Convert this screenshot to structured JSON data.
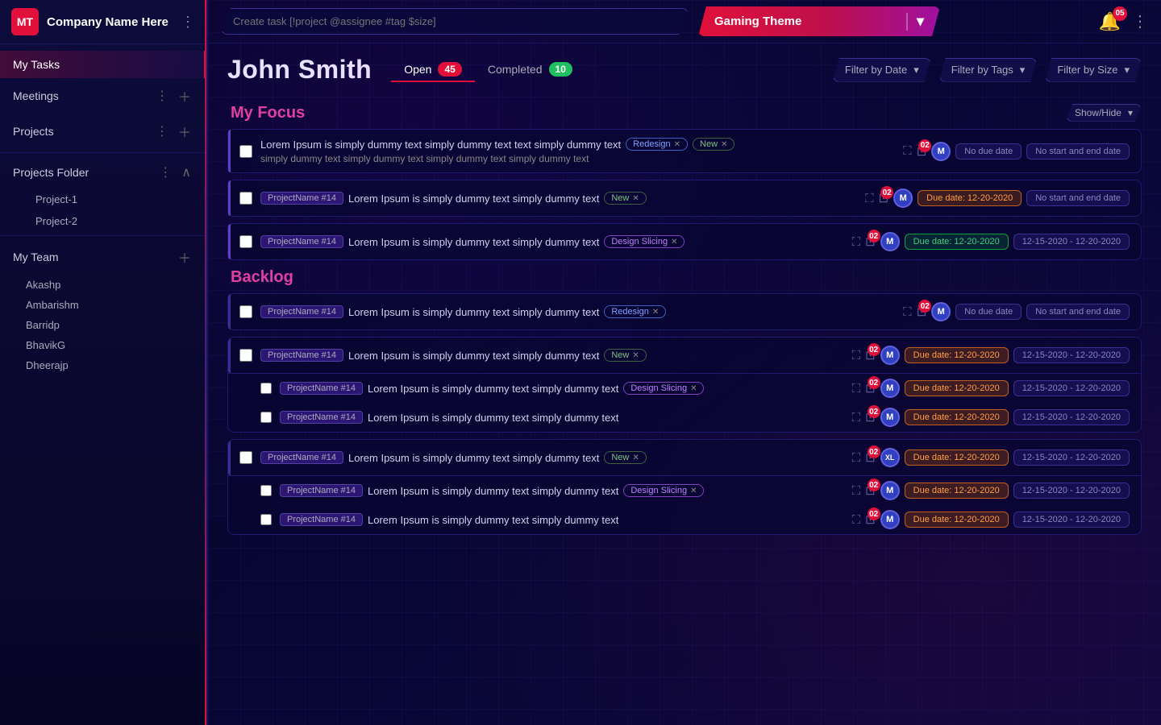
{
  "app": {
    "logo": "MT",
    "company": "Company Name Here"
  },
  "sidebar": {
    "my_tasks_label": "My Tasks",
    "meetings_label": "Meetings",
    "projects_label": "Projects",
    "projects_folder_label": "Projects Folder",
    "project1_label": "Project-1",
    "project2_label": "Project-2",
    "my_team_label": "My Team",
    "team_members": [
      "Akashp",
      "Ambarishm",
      "Barridp",
      "BhavikG",
      "Dheerajp"
    ]
  },
  "topbar": {
    "create_task_placeholder": "Create task [!project @assignee #tag $size]",
    "gaming_theme_label": "Gaming Theme",
    "notif_count": "05",
    "notif_count_num": 5
  },
  "user_header": {
    "name": "John Smith",
    "open_label": "Open",
    "open_count": "45",
    "completed_label": "Completed",
    "completed_count": "10",
    "filter_date": "Filter by Date",
    "filter_tags": "Filter by Tags",
    "filter_size": "Filter by Size"
  },
  "my_focus": {
    "title": "My Focus",
    "show_hide_label": "Show/Hide",
    "tasks": [
      {
        "id": "focus-1",
        "text": "Lorem Ipsum is simply dummy text simply dummy text text simply dummy text simply dummy text simply dummy text simply dummy text",
        "tags": [
          "Redesign",
          "New"
        ],
        "due_label": "No due date",
        "date_range_label": "No start and end date",
        "due_type": "no-date",
        "range_type": "no-date",
        "subtask_count": "02",
        "assignee_initial": "M",
        "project": ""
      },
      {
        "id": "focus-2",
        "project": "ProjectName #14",
        "text": "Lorem Ipsum is simply dummy text simply dummy text",
        "tags": [
          "New"
        ],
        "due_label": "Due date: 12-20-2020",
        "date_range_label": "No start and end date",
        "due_type": "overdue",
        "range_type": "no-date",
        "subtask_count": "02",
        "assignee_initial": "M"
      },
      {
        "id": "focus-3",
        "project": "ProjectName #14",
        "text": "Lorem Ipsum is simply dummy text simply dummy text",
        "tags": [
          "Design Slicing"
        ],
        "due_label": "Due date: 12-20-2020",
        "date_range_label": "12-15-2020 - 12-20-2020",
        "due_type": "upcoming",
        "range_type": "range",
        "subtask_count": "02",
        "assignee_initial": "M"
      }
    ]
  },
  "backlog": {
    "title": "Backlog",
    "groups": [
      {
        "id": "backlog-1",
        "main_task": {
          "project": "ProjectName #14",
          "text": "Lorem Ipsum is simply dummy text simply dummy text",
          "tags": [
            "Redesign"
          ],
          "due_label": "No due date",
          "date_range_label": "No start and end date",
          "due_type": "no-date",
          "range_type": "no-date",
          "subtask_count": "02",
          "assignee_initial": "M"
        },
        "sub_tasks": []
      },
      {
        "id": "backlog-2",
        "main_task": {
          "project": "ProjectName #14",
          "text": "Lorem Ipsum is simply dummy text simply dummy text",
          "tags": [
            "New"
          ],
          "due_label": "Due date: 12-20-2020",
          "date_range_label": "12-15-2020 - 12-20-2020",
          "due_type": "overdue",
          "range_type": "range",
          "subtask_count": "02",
          "assignee_initial": "M"
        },
        "sub_tasks": [
          {
            "project": "ProjectName #14",
            "text": "Lorem Ipsum is simply dummy text simply dummy text",
            "tags": [
              "Design Slicing"
            ],
            "due_label": "Due date: 12-20-2020",
            "date_range_label": "12-15-2020 - 12-20-2020",
            "due_type": "overdue",
            "range_type": "range",
            "subtask_count": "02",
            "assignee_initial": "M"
          },
          {
            "project": "ProjectName #14",
            "text": "Lorem Ipsum is simply dummy text simply dummy text",
            "tags": [],
            "due_label": "Due date: 12-20-2020",
            "date_range_label": "12-15-2020 - 12-20-2020",
            "due_type": "overdue",
            "range_type": "range",
            "subtask_count": "02",
            "assignee_initial": "M"
          }
        ]
      },
      {
        "id": "backlog-3",
        "main_task": {
          "project": "ProjectName #14",
          "text": "Lorem Ipsum is simply dummy text simply dummy text",
          "tags": [
            "New"
          ],
          "due_label": "Due date: 12-20-2020",
          "date_range_label": "12-15-2020 - 12-20-2020",
          "due_type": "overdue",
          "range_type": "range",
          "subtask_count": "02",
          "assignee_initial": "XL"
        },
        "sub_tasks": [
          {
            "project": "ProjectName #14",
            "text": "Lorem Ipsum is simply dummy text simply dummy text",
            "tags": [
              "Design Slicing"
            ],
            "due_label": "Due date: 12-20-2020",
            "date_range_label": "12-15-2020 - 12-20-2020",
            "due_type": "overdue",
            "range_type": "range",
            "subtask_count": "02",
            "assignee_initial": "M"
          },
          {
            "project": "ProjectName #14",
            "text": "Lorem Ipsum is simply dummy text simply dummy text",
            "tags": [],
            "due_label": "Due date: 12-20-2020",
            "date_range_label": "12-15-2020 - 12-20-2020",
            "due_type": "overdue",
            "range_type": "range",
            "subtask_count": "02",
            "assignee_initial": "M"
          }
        ]
      }
    ]
  }
}
